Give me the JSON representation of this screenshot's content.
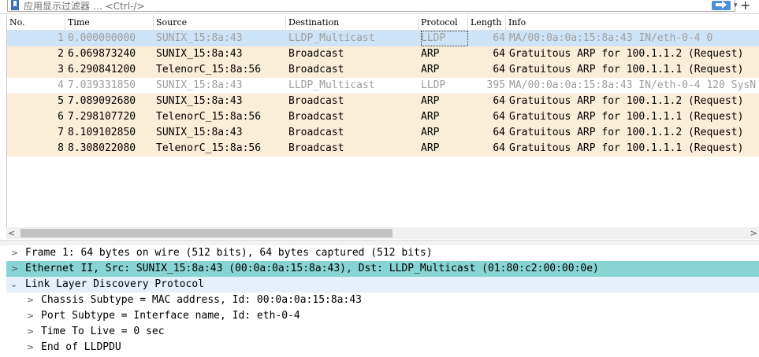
{
  "filter": {
    "placeholder": "应用显示过滤器 … <Ctrl-/>",
    "bookmark_icon": "bookmark-icon",
    "apply_icon": "arrow-right-icon",
    "dropdown_icon": "chevron-down-icon",
    "add_label": "+"
  },
  "columns": {
    "no": "No.",
    "time": "Time",
    "source": "Source",
    "destination": "Destination",
    "protocol": "Protocol",
    "length": "Length",
    "info": "Info"
  },
  "packets": [
    {
      "no": "1",
      "time": "0.000000000",
      "source": "SUNIX_15:8a:43",
      "destination": "LLDP_Multicast",
      "protocol": "LLDP",
      "length": "64",
      "info": "MA/00:0a:0a:15:8a:43 IN/eth-0-4 0"
    },
    {
      "no": "2",
      "time": "6.069873240",
      "source": "SUNIX_15:8a:43",
      "destination": "Broadcast",
      "protocol": "ARP",
      "length": "64",
      "info": "Gratuitous ARP for 100.1.1.2 (Request)"
    },
    {
      "no": "3",
      "time": "6.290841200",
      "source": "TelenorC_15:8a:56",
      "destination": "Broadcast",
      "protocol": "ARP",
      "length": "64",
      "info": "Gratuitous ARP for 100.1.1.1 (Request)"
    },
    {
      "no": "4",
      "time": "7.039331850",
      "source": "SUNIX_15:8a:43",
      "destination": "LLDP_Multicast",
      "protocol": "LLDP",
      "length": "395",
      "info": "MA/00:0a:0a:15:8a:43 IN/eth-0-4 120 SysN"
    },
    {
      "no": "5",
      "time": "7.089092680",
      "source": "SUNIX_15:8a:43",
      "destination": "Broadcast",
      "protocol": "ARP",
      "length": "64",
      "info": "Gratuitous ARP for 100.1.1.2 (Request)"
    },
    {
      "no": "6",
      "time": "7.298107720",
      "source": "TelenorC_15:8a:56",
      "destination": "Broadcast",
      "protocol": "ARP",
      "length": "64",
      "info": "Gratuitous ARP for 100.1.1.1 (Request)"
    },
    {
      "no": "7",
      "time": "8.109102850",
      "source": "SUNIX_15:8a:43",
      "destination": "Broadcast",
      "protocol": "ARP",
      "length": "64",
      "info": "Gratuitous ARP for 100.1.1.2 (Request)"
    },
    {
      "no": "8",
      "time": "8.308022080",
      "source": "TelenorC_15:8a:56",
      "destination": "Broadcast",
      "protocol": "ARP",
      "length": "64",
      "info": "Gratuitous ARP for 100.1.1.1 (Request)"
    }
  ],
  "details": {
    "frame": "Frame 1: 64 bytes on wire (512 bits), 64 bytes captured (512 bits)",
    "ethernet": "Ethernet II, Src: SUNIX_15:8a:43 (00:0a:0a:15:8a:43), Dst: LLDP_Multicast (01:80:c2:00:00:0e)",
    "lldp": "Link Layer Discovery Protocol",
    "chassis": "Chassis Subtype = MAC address, Id: 00:0a:0a:15:8a:43",
    "port": "Port Subtype = Interface name, Id: eth-0-4",
    "ttl": "Time To Live = 0 sec",
    "end": "End of LLDPDU"
  },
  "colors": {
    "arp_row": "#fbeed8",
    "selected_row": "#cde3f7",
    "selected_detail": "#88d4d4",
    "apply_button": "#4f8ed6"
  }
}
